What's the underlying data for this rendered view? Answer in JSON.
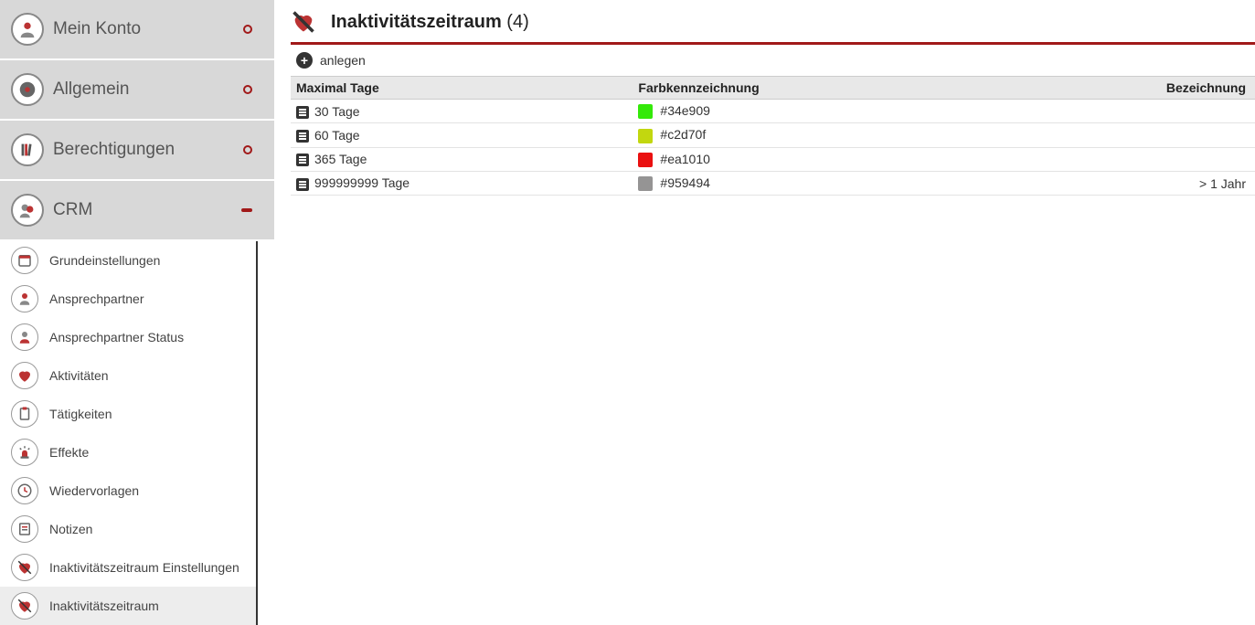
{
  "sidebar": {
    "top": [
      {
        "label": "Mein Konto",
        "icon": "user"
      },
      {
        "label": "Allgemein",
        "icon": "disc"
      },
      {
        "label": "Berechtigungen",
        "icon": "books"
      },
      {
        "label": "CRM",
        "icon": "users",
        "open": true
      }
    ],
    "sub": [
      {
        "label": "Grundeinstellungen",
        "icon": "calendar"
      },
      {
        "label": "Ansprechpartner",
        "icon": "user"
      },
      {
        "label": "Ansprechpartner Status",
        "icon": "user-status"
      },
      {
        "label": "Aktivitäten",
        "icon": "heart"
      },
      {
        "label": "Tätigkeiten",
        "icon": "clipboard"
      },
      {
        "label": "Effekte",
        "icon": "siren"
      },
      {
        "label": "Wiedervorlagen",
        "icon": "clock"
      },
      {
        "label": "Notizen",
        "icon": "notes"
      },
      {
        "label": "Inaktivitätszeitraum Einstellungen",
        "icon": "heart-slash"
      },
      {
        "label": "Inaktivitätszeitraum",
        "icon": "heart-slash",
        "active": true
      }
    ]
  },
  "page": {
    "title": "Inaktivitätszeitraum",
    "count": "(4)"
  },
  "toolbar": {
    "add_label": "anlegen"
  },
  "table": {
    "headers": {
      "max_days": "Maximal Tage",
      "color": "Farbkennzeichnung",
      "name": "Bezeichnung"
    },
    "rows": [
      {
        "max_days": "30 Tage",
        "color": "#34e909",
        "color_label": "#34e909",
        "name": ""
      },
      {
        "max_days": "60 Tage",
        "color": "#c2d70f",
        "color_label": "#c2d70f",
        "name": ""
      },
      {
        "max_days": "365 Tage",
        "color": "#ea1010",
        "color_label": "#ea1010",
        "name": ""
      },
      {
        "max_days": "999999999 Tage",
        "color": "#959494",
        "color_label": "#959494",
        "name": "> 1 Jahr"
      }
    ]
  }
}
